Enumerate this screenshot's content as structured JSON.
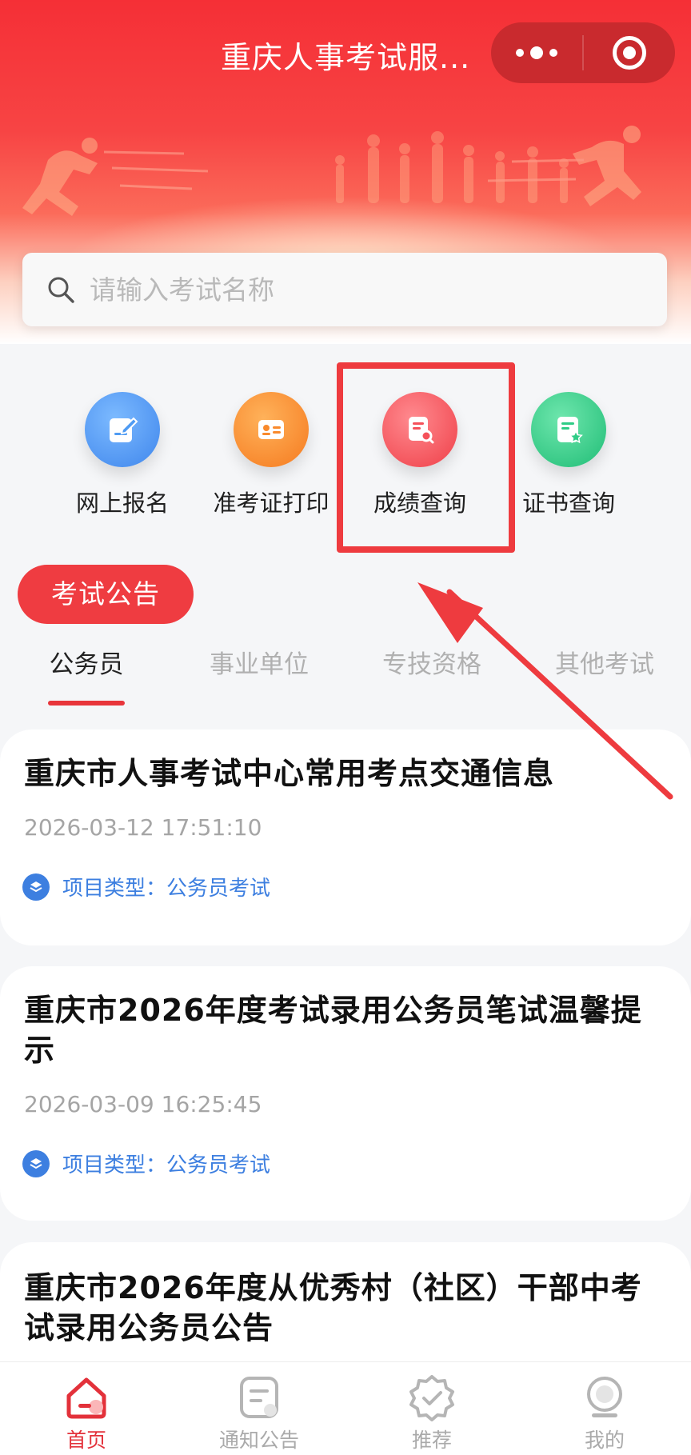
{
  "app": {
    "title": "重庆人事考试服..."
  },
  "capsule": {
    "more_icon": "more-dots-icon",
    "close_icon": "target-circle-icon"
  },
  "search": {
    "placeholder": "请输入考试名称",
    "icon": "search-icon"
  },
  "quick_entries": [
    {
      "label": "网上报名",
      "icon": "edit-form-icon",
      "color": "#4f9bf3"
    },
    {
      "label": "准考证打印",
      "icon": "id-card-icon",
      "color": "#f98a2c"
    },
    {
      "label": "成绩查询",
      "icon": "score-search-icon",
      "color": "#f5515a"
    },
    {
      "label": "证书查询",
      "icon": "certificate-icon",
      "color": "#2fcc86"
    }
  ],
  "highlighted_entry": "成绩查询",
  "section": {
    "tag": "考试公告"
  },
  "tabs": [
    {
      "label": "公务员",
      "active": true
    },
    {
      "label": "事业单位",
      "active": false
    },
    {
      "label": "专技资格",
      "active": false
    },
    {
      "label": "其他考试",
      "active": false
    }
  ],
  "announcements": [
    {
      "title": "重庆市人事考试中心常用考点交通信息",
      "date": "2026-03-12 17:51:10",
      "meta": "项目类型：公务员考试"
    },
    {
      "title": "重庆市2026年度考试录用公务员笔试温馨提示",
      "date": "2026-03-09 16:25:45",
      "meta": "项目类型：公务员考试"
    },
    {
      "title": "重庆市2026年度从优秀村（社区）干部中考试录用公务员公告",
      "date": "",
      "meta": ""
    }
  ],
  "bottom_nav": [
    {
      "label": "首页",
      "icon": "home-icon",
      "active": true
    },
    {
      "label": "通知公告",
      "icon": "notice-icon",
      "active": false
    },
    {
      "label": "推荐",
      "icon": "recommend-badge-icon",
      "active": false
    },
    {
      "label": "我的",
      "icon": "profile-icon",
      "active": false
    }
  ],
  "colors": {
    "brand_red": "#ef3c41",
    "active_tab_text": "#222222",
    "inactive_tab_text": "#b0b0b0",
    "meta_blue": "#3d7fe0",
    "annotation_red": "#ee3b3f"
  }
}
